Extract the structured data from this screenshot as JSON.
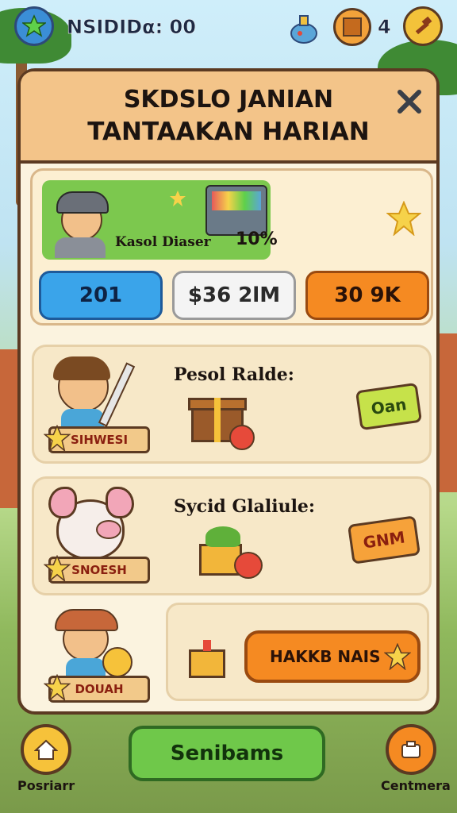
{
  "hud": {
    "left_badge_icon": "star-icon",
    "score_text": "ΝSIDIDα:  00",
    "items_icon": "potion-icon",
    "crate_icon": "crate-icon",
    "crate_count": "4",
    "hammer_icon": "hammer-icon"
  },
  "panel": {
    "title_line1": "SKDSLO JANIAN",
    "title_line2": "TANTAAKAN HARIAN",
    "close_icon": "close-icon"
  },
  "hero": {
    "name": "Kasol Diaser",
    "percent": "10%",
    "star_icon": "star-icon",
    "stats": [
      "201",
      "$36 2lM",
      "30 9K"
    ]
  },
  "quests": [
    {
      "label": "Pesol Ralde:",
      "ribbon": "SIHWESI",
      "reward": "Oan",
      "reward_color": "#c6e24a"
    },
    {
      "label": "Sycid Glaliule:",
      "ribbon": "SNOESH",
      "reward": "GNM",
      "reward_color": "#f6a23a"
    },
    {
      "label": "",
      "ribbon": "DOUAH",
      "reward": "HAKKB NAIS",
      "reward_color": "#f58a22"
    }
  ],
  "bottom": {
    "left_label": "Posriarr",
    "left_icon": "home-icon",
    "center_button": "Senibams",
    "right_label": "Centmera",
    "right_icon": "camera-icon"
  },
  "colors": {
    "frame": "#5b3a22",
    "header": "#f3c489",
    "blue_btn": "#3aa4ea",
    "white_btn": "#f4f4f4",
    "orange_btn": "#f58a22",
    "green_btn": "#6fc84a"
  }
}
